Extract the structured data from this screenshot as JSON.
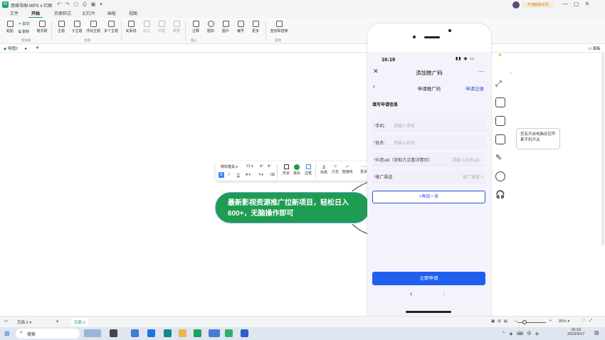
{
  "titlebar": {
    "app_icon": "mindmap-app-icon",
    "title": "思维导图-WPS x 亿图",
    "vip_label": "开通超级会员",
    "window_controls": [
      "—",
      "▢",
      "✕"
    ]
  },
  "menu": {
    "tabs": [
      "文件",
      "开始",
      "页面样式",
      "幻灯片",
      "画板",
      "视图"
    ],
    "active": "开始"
  },
  "ribbon": {
    "clipboard": {
      "paste": "粘贴",
      "cut": "剪切",
      "copy": "复制",
      "format_painter": "格式刷",
      "group": "剪贴板"
    },
    "topic": {
      "items": [
        "主题",
        "子主题",
        "浮动主题",
        "多个主题"
      ],
      "group": "主题"
    },
    "insert": {
      "items": [
        "关系线",
        "标注",
        "外框",
        "概要",
        "注释",
        "图标",
        "图片",
        "编号",
        "更多"
      ],
      "group": "插入"
    },
    "find": {
      "label": "查找和替换",
      "group": "查找"
    }
  },
  "doc_tabs": {
    "current": "导图2",
    "right_label": "面板"
  },
  "mini_toolbar": {
    "font": "微软雅黑",
    "size": "21",
    "inc": "A⁺",
    "dec": "A⁻",
    "bold": "B",
    "italic": "I",
    "underline": "U",
    "color": "A",
    "items": [
      "形状",
      "填充",
      "边框",
      "布局",
      "分支",
      "连接线",
      "更多"
    ]
  },
  "topic": {
    "text_line1": "最新影视资源推广拉新项目，轻松日入",
    "text_line2": "600+，无脑操作即可"
  },
  "phone": {
    "time": "16:19",
    "status_icons": "▮▮ ◉ ▭",
    "header_title": "添加推广码",
    "sub_title": "申请推广码",
    "record_link": "申请记录",
    "section": "填写申请信息",
    "fields": [
      {
        "label": "手机:",
        "placeholder": "请输入手机"
      },
      {
        "label": "姓名:",
        "placeholder": "请输入姓名"
      },
      {
        "label": "抖音uid（获取方式看详情页）",
        "placeholder": "请输入抖音uid"
      },
      {
        "label": "推广渠道",
        "placeholder": "推广渠道 >"
      }
    ],
    "add_button": "+再加一条",
    "submit_button": "立即申请"
  },
  "side_tooltip": "您有开启电脑反控苹果手机开关",
  "statusbar": {
    "page_selector": "页面-2",
    "page_tab": "页面-2",
    "zoom": "85%"
  },
  "taskbar": {
    "search": "搜索",
    "time": "16:19",
    "date": "2023/9/17"
  },
  "colors": {
    "topic_fill": "#1e9c52",
    "brand_green": "#1aa260",
    "link_blue": "#2451d6",
    "submit_blue": "#1f5ff0"
  }
}
